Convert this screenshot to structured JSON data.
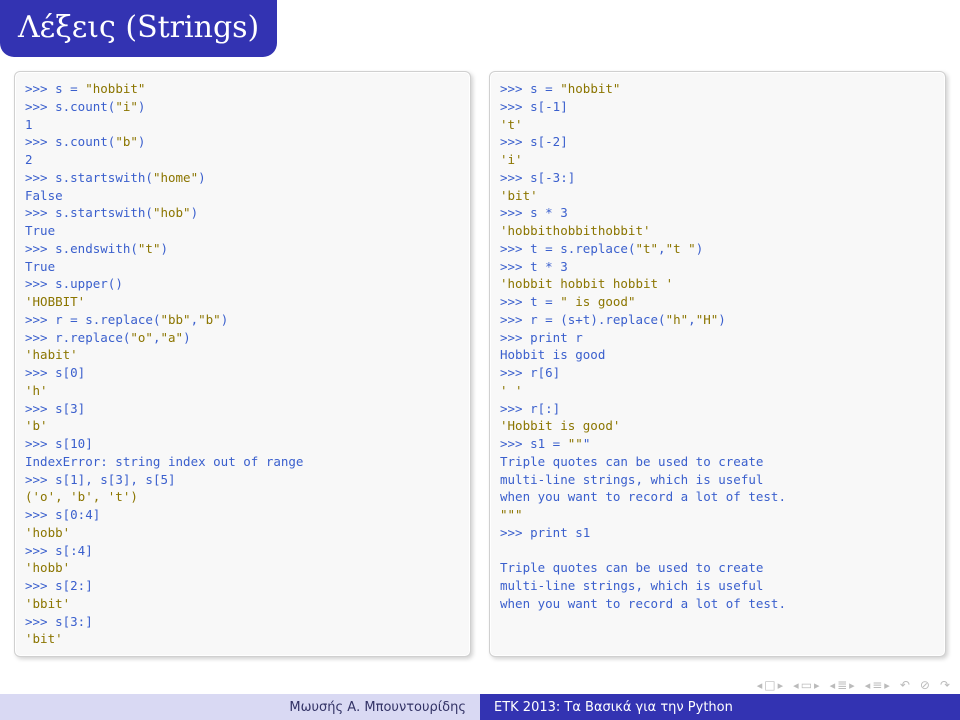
{
  "title": "Λέξεις (Strings)",
  "left_code": ">>> s = \"hobbit\"\n>>> s.count(\"i\")\n1\n>>> s.count(\"b\")\n2\n>>> s.startswith(\"home\")\nFalse\n>>> s.startswith(\"hob\")\nTrue\n>>> s.endswith(\"t\")\nTrue\n>>> s.upper()\n'HOBBIT'\n>>> r = s.replace(\"bb\",\"b\")\n>>> r.replace(\"o\",\"a\")\n'habit'\n>>> s[0]\n'h'\n>>> s[3]\n'b'\n>>> s[10]\nIndexError: string index out of range\n>>> s[1], s[3], s[5]\n('o', 'b', 't')\n>>> s[0:4]\n'hobb'\n>>> s[:4]\n'hobb'\n>>> s[2:]\n'bbit'\n>>> s[3:]\n'bit'",
  "right_code": ">>> s = \"hobbit\"\n>>> s[-1]\n't'\n>>> s[-2]\n'i'\n>>> s[-3:]\n'bit'\n>>> s * 3\n'hobbithobbithobbit'\n>>> t = s.replace(\"t\",\"t \")\n>>> t * 3\n'hobbit hobbit hobbit '\n>>> t = \" is good\"\n>>> r = (s+t).replace(\"h\",\"H\")\n>>> print r\nHobbit is good\n>>> r[6]\n' '\n>>> r[:]\n'Hobbit is good'\n>>> s1 = \"\"\"\nTriple quotes can be used to create\nmulti-line strings, which is useful\nwhen you want to record a lot of test.\n\"\"\"\n>>> print s1\n\nTriple quotes can be used to create\nmulti-line strings, which is useful\nwhen you want to record a lot of test.",
  "footer_left": "Μωυσής Α. Μπουντουρίδης",
  "footer_right": "ΕΤΚ 2013: Τα Βασικά για την Python",
  "nav": {
    "back_sq": "◻",
    "fwd_sq": "◻",
    "back_pg": "◻",
    "fwd_pg": "◻",
    "back_sec": "≡",
    "fwd_sec": "≡",
    "undo": "↶",
    "circ": "↻"
  }
}
